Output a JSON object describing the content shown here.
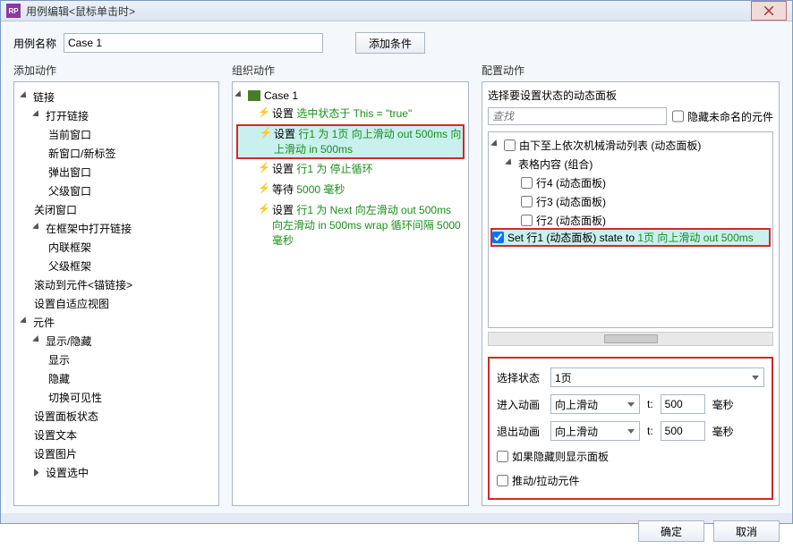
{
  "window": {
    "app_icon": "RP",
    "title": "用例编辑<鼠标单击时>"
  },
  "top": {
    "case_label": "用例名称",
    "case_value": "Case 1",
    "add_condition": "添加条件"
  },
  "columns": {
    "left_header": "添加动作",
    "mid_header": "组织动作",
    "right_header": "配置动作"
  },
  "left_tree": {
    "links": "链接",
    "open_link": "打开链接",
    "current_window": "当前窗口",
    "new_window": "新窗口/新标签",
    "popup": "弹出窗口",
    "parent_window": "父级窗口",
    "close_window": "关闭窗口",
    "open_in_frame": "在框架中打开链接",
    "inline_frame": "内联框架",
    "parent_frame": "父级框架",
    "scroll_to": "滚动到元件<锚链接>",
    "adaptive": "设置自适应视图",
    "widgets": "元件",
    "show_hide": "显示/隐藏",
    "show": "显示",
    "hide": "隐藏",
    "toggle_vis": "切换可见性",
    "panel_state": "设置面板状态",
    "set_text": "设置文本",
    "set_image": "设置图片",
    "set_selected": "设置选中"
  },
  "mid": {
    "case_root": "Case 1",
    "a1_prefix": "设置 ",
    "a1_green": "选中状态于 This = \"true\"",
    "a2_prefix": "设置 ",
    "a2_green": "行1 为 1页 向上滑动 out 500ms 向上滑动 in 500ms",
    "a3_prefix": "设置 ",
    "a3_green": "行1 为 停止循环",
    "a4_prefix": "等待 ",
    "a4_green": "5000 毫秒",
    "a5_prefix": "设置 ",
    "a5_green": "行1 为 Next 向左滑动 out 500ms 向左滑动 in 500ms wrap 循环间隔 5000 毫秒"
  },
  "right": {
    "choose_panel": "选择要设置状态的动态面板",
    "search_placeholder": "查找",
    "hide_unnamed": "隐藏未命名的元件",
    "root_item": "由下至上依次机械滑动列表 (动态面板)",
    "group": "表格内容 (组合)",
    "row4": "行4 (动态面板)",
    "row3": "行3 (动态面板)",
    "row2": "行2 (动态面板)",
    "row1_set_prefix": "Set 行1 (动态面板) state to ",
    "row1_set_green": "1页 向上滑动 out 500ms",
    "select_state_lbl": "选择状态",
    "select_state_val": "1页",
    "enter_anim_lbl": "进入动画",
    "exit_anim_lbl": "退出动画",
    "anim_val": "向上滑动",
    "t_lbl": "t:",
    "t_val": "500",
    "ms": "毫秒",
    "show_if_hidden": "如果隐藏则显示面板",
    "push_pull": "推动/拉动元件"
  },
  "footer": {
    "ok": "确定",
    "cancel": "取消"
  }
}
